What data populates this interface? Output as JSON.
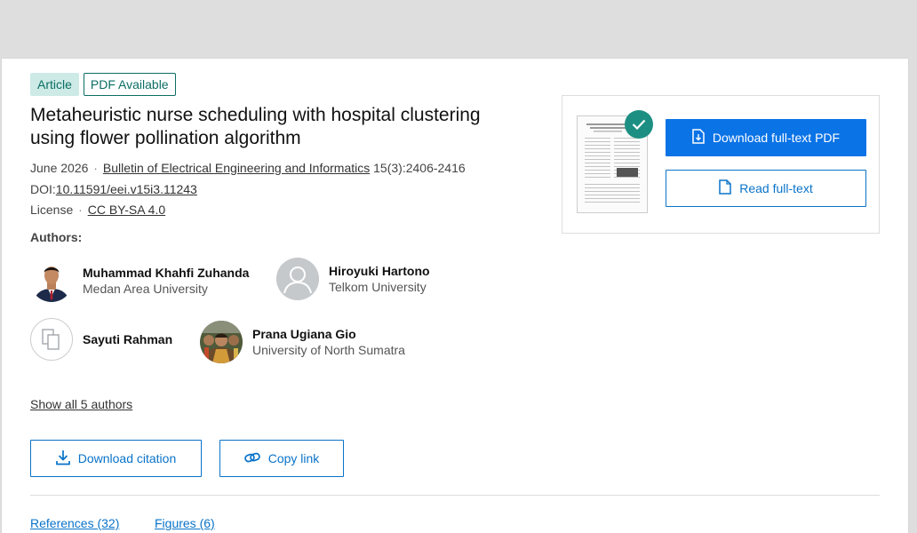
{
  "badges": {
    "article": "Article",
    "pdf": "PDF Available"
  },
  "title": "Metaheuristic nurse scheduling with hospital clustering using flower pollination algorithm",
  "meta": {
    "date": "June 2026",
    "journal": "Bulletin of Electrical Engineering and Informatics",
    "volume": "15(3):2406-2416",
    "doi_label": "DOI:",
    "doi": "10.11591/eei.v15i3.11243",
    "license_label": "License",
    "license": "CC BY-SA 4.0",
    "separator": "·"
  },
  "authors_label": "Authors:",
  "authors": [
    {
      "name": "Muhammad Khahfi Zuhanda",
      "affiliation": "Medan Area University"
    },
    {
      "name": "Hiroyuki Hartono",
      "affiliation": "Telkom University"
    },
    {
      "name": "Sayuti Rahman",
      "affiliation": ""
    },
    {
      "name": "Prana Ugiana Gio",
      "affiliation": "University of North Sumatra"
    }
  ],
  "show_all": "Show all 5 authors",
  "actions": {
    "download_citation": "Download citation",
    "copy_link": "Copy link"
  },
  "tabs": {
    "references": "References (32)",
    "figures": "Figures (6)"
  },
  "pdf_panel": {
    "download": "Download full-text PDF",
    "read": "Read full-text"
  },
  "colors": {
    "accent": "#0a73e6",
    "teal": "#0b6e64",
    "check": "#1d8f82"
  },
  "icons": [
    "download-file-icon",
    "document-icon",
    "download-icon",
    "link-icon",
    "checkmark-icon",
    "default-avatar-icon",
    "no-photo-icon"
  ]
}
